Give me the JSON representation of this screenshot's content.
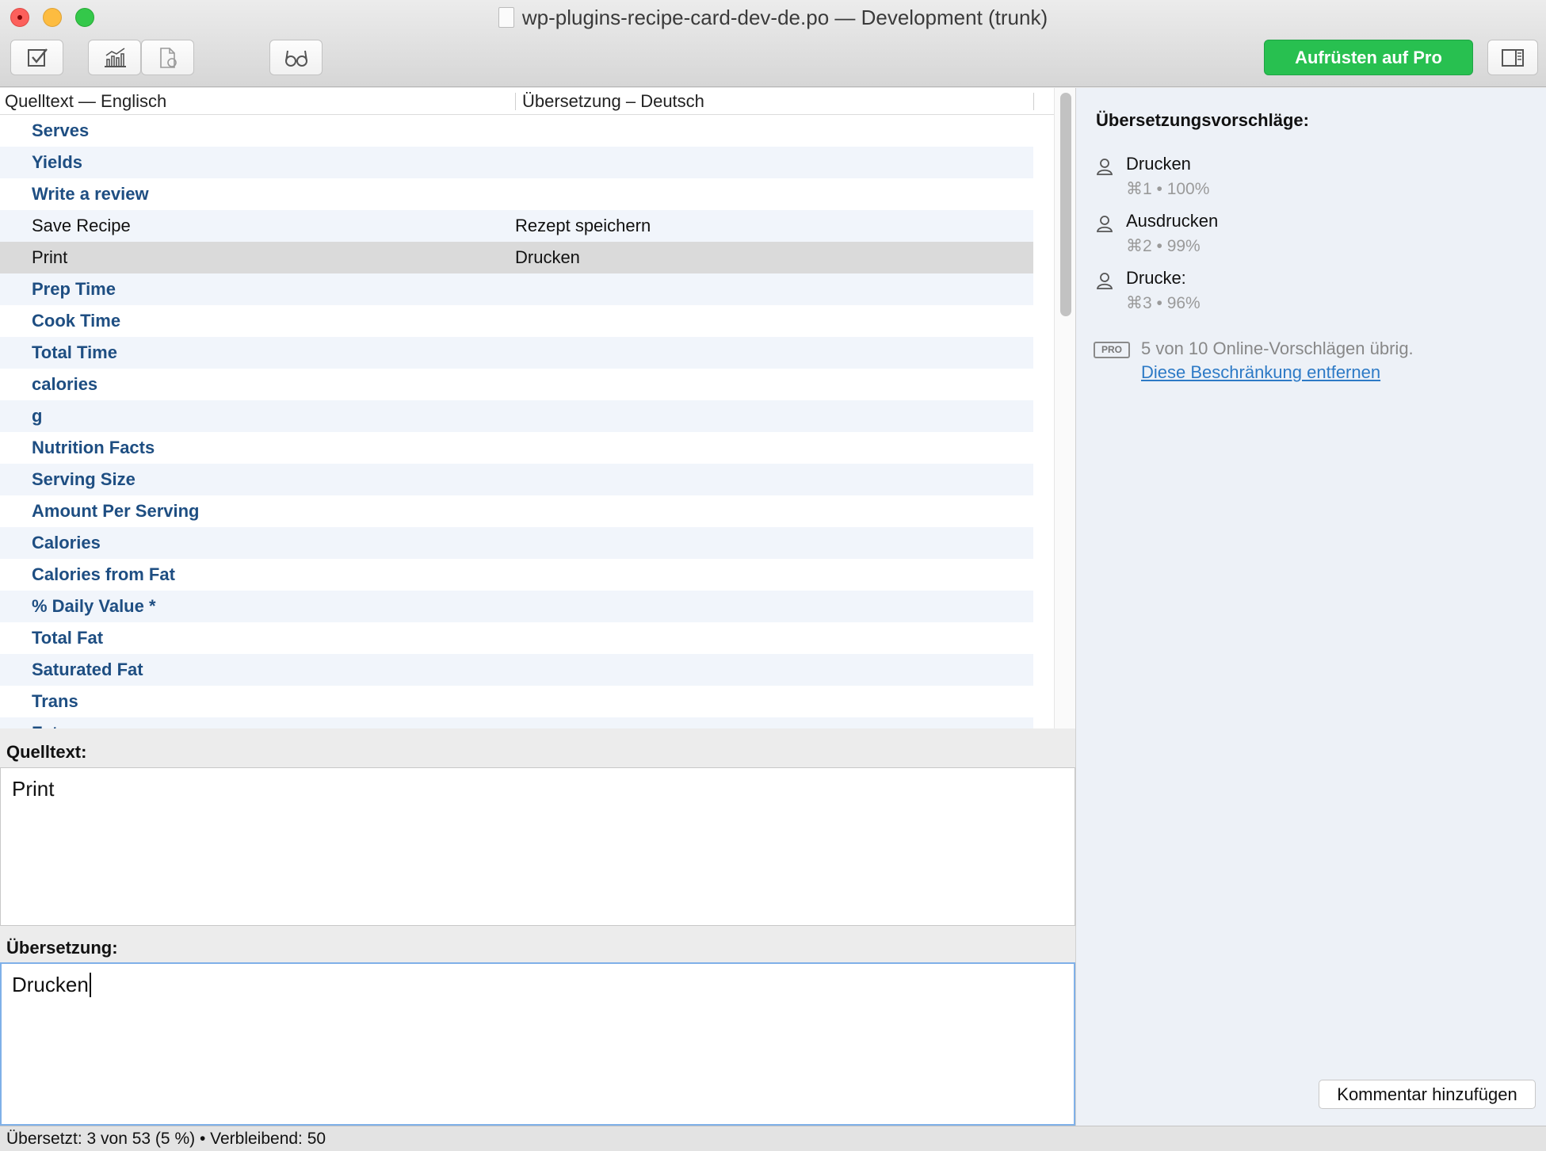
{
  "window": {
    "title": "wp-plugins-recipe-card-dev-de.po — Development (trunk)"
  },
  "toolbar": {
    "validate_icon": "checkbox-icon",
    "stats_icon": "bar-chart-icon",
    "sync_icon": "document-sync-icon",
    "preview_icon": "glasses-icon",
    "sidebar_icon": "sidebar-toggle-icon",
    "pro_label": "Aufrüsten auf Pro"
  },
  "colors": {
    "accent_green": "#28c050",
    "untranslated_text": "#1e4e82",
    "link": "#2d7ac6",
    "selected_row": "#dadada"
  },
  "list": {
    "source_header": "Quelltext — Englisch",
    "target_header": "Übersetzung – Deutsch",
    "rows": [
      {
        "source": "Serves",
        "translation": "",
        "state": "untranslated"
      },
      {
        "source": "Yields",
        "translation": "",
        "state": "untranslated"
      },
      {
        "source": "Write a review",
        "translation": "",
        "state": "untranslated"
      },
      {
        "source": "Save Recipe",
        "translation": "Rezept speichern",
        "state": "translated"
      },
      {
        "source": "Print",
        "translation": "Drucken",
        "state": "translated",
        "selected": true
      },
      {
        "source": "Prep Time",
        "translation": "",
        "state": "untranslated"
      },
      {
        "source": "Cook Time",
        "translation": "",
        "state": "untranslated"
      },
      {
        "source": "Total Time",
        "translation": "",
        "state": "untranslated"
      },
      {
        "source": "calories",
        "translation": "",
        "state": "untranslated"
      },
      {
        "source": "g",
        "translation": "",
        "state": "untranslated"
      },
      {
        "source": "Nutrition Facts",
        "translation": "",
        "state": "untranslated"
      },
      {
        "source": "Serving Size",
        "translation": "",
        "state": "untranslated"
      },
      {
        "source": "Amount Per Serving",
        "translation": "",
        "state": "untranslated"
      },
      {
        "source": "Calories",
        "translation": "",
        "state": "untranslated"
      },
      {
        "source": "Calories from Fat",
        "translation": "",
        "state": "untranslated"
      },
      {
        "source": "% Daily Value *",
        "translation": "",
        "state": "untranslated"
      },
      {
        "source": "Total Fat",
        "translation": "",
        "state": "untranslated"
      },
      {
        "source": "Saturated Fat",
        "translation": "",
        "state": "untranslated"
      },
      {
        "source": "Trans",
        "translation": "",
        "state": "untranslated"
      },
      {
        "source": "Fat",
        "translation": "",
        "state": "untranslated"
      }
    ]
  },
  "editor": {
    "source_label": "Quelltext:",
    "source_text": "Print",
    "translation_label": "Übersetzung:",
    "translation_text": "Drucken"
  },
  "sidebar": {
    "title": "Übersetzungsvorschläge:",
    "suggestions": [
      {
        "text": "Drucken",
        "meta": "⌘1 • 100%",
        "icon": "person-icon"
      },
      {
        "text": "Ausdrucken",
        "meta": "⌘2 • 99%",
        "icon": "person-icon"
      },
      {
        "text": "Drucke:",
        "meta": "⌘3 • 96%",
        "icon": "person-icon"
      }
    ],
    "pro_badge": "PRO",
    "online_quota": "5 von 10 Online-Vorschlägen übrig.",
    "remove_limit_link": "Diese Beschränkung entfernen",
    "comment_button": "Kommentar hinzufügen"
  },
  "status": {
    "text": "Übersetzt: 3 von 53 (5 %)  •  Verbleibend: 50"
  }
}
